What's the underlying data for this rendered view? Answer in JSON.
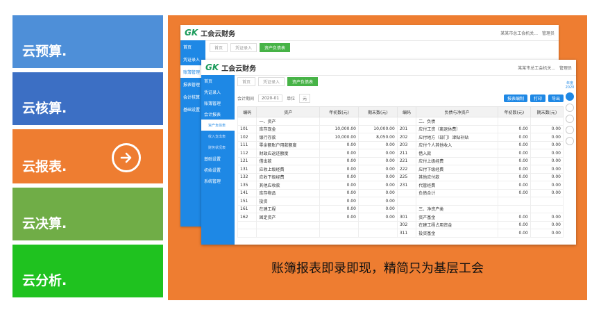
{
  "tiles": [
    {
      "label": "云预算."
    },
    {
      "label": "云核算."
    },
    {
      "label": "云报表."
    },
    {
      "label": "云决算."
    },
    {
      "label": "云分析."
    }
  ],
  "caption": "账簿报表即录即现，精简只为基层工会",
  "app": {
    "logo_mark": "GK",
    "title": "工会云财务",
    "org": "某某市总工会机关...",
    "user": "管理员"
  },
  "back_sidebar": [
    "首页",
    "凭证录入",
    "账簿管理",
    "报表管理",
    "会计核算",
    "基础设置"
  ],
  "front_sidebar": [
    {
      "label": "首页",
      "sub": false
    },
    {
      "label": "凭证录入",
      "sub": false
    },
    {
      "label": "账簿管理",
      "sub": false
    },
    {
      "label": "会计报表",
      "sub": false
    },
    {
      "label": "资产负债表",
      "sub": true,
      "on": true
    },
    {
      "label": "收入支出表",
      "sub": true
    },
    {
      "label": "财务状况表",
      "sub": true
    },
    {
      "label": "基础设置",
      "sub": false
    },
    {
      "label": "初始设置",
      "sub": false
    },
    {
      "label": "系统管理",
      "sub": false
    }
  ],
  "tabs": [
    "首页",
    "凭证录入",
    "资产负债表"
  ],
  "filters": {
    "period_label": "会计期间",
    "period": "2020-01",
    "unit_label": "单位",
    "unit": "元"
  },
  "buttons": [
    "报表编制",
    "打印",
    "导出"
  ],
  "year": {
    "label": "年度",
    "value": "2020"
  },
  "table": {
    "headers": [
      "编码",
      "资产",
      "年初数(元)",
      "期末数(元)",
      "编码",
      "负债与净资产",
      "年初数(元)",
      "期末数(元)"
    ],
    "rows": [
      [
        "",
        "一、资产",
        "",
        "",
        "",
        "二、负债",
        "",
        ""
      ],
      [
        "101",
        "库存现金",
        "10,000.00",
        "10,000.00",
        "201",
        "应付工资（离退休费）",
        "0.00",
        "0.00"
      ],
      [
        "102",
        "银行存款",
        "10,000.00",
        "8,050.00",
        "202",
        "应付地方（部门）津贴补贴",
        "0.00",
        "0.00"
      ],
      [
        "111",
        "零余额账户用款额度",
        "0.00",
        "0.00",
        "203",
        "应付个人其他收入",
        "0.00",
        "0.00"
      ],
      [
        "112",
        "财政应返还额度",
        "0.00",
        "0.00",
        "211",
        "借入款",
        "0.00",
        "0.00"
      ],
      [
        "121",
        "借出款",
        "0.00",
        "0.00",
        "221",
        "应付上级经费",
        "0.00",
        "0.00"
      ],
      [
        "131",
        "应收上级经费",
        "0.00",
        "0.00",
        "222",
        "应付下级经费",
        "0.00",
        "0.00"
      ],
      [
        "132",
        "应收下级经费",
        "0.00",
        "0.00",
        "225",
        "其他应付款",
        "0.00",
        "0.00"
      ],
      [
        "135",
        "其他应收款",
        "0.00",
        "0.00",
        "231",
        "代管经费",
        "0.00",
        "0.00"
      ],
      [
        "141",
        "库存物品",
        "0.00",
        "0.00",
        "",
        "负债合计",
        "0.00",
        "0.00"
      ],
      [
        "151",
        "投资",
        "0.00",
        "0.00",
        "",
        "",
        "",
        ""
      ],
      [
        "161",
        "在建工程",
        "0.00",
        "0.00",
        "",
        "三、净资产类",
        "",
        ""
      ],
      [
        "162",
        "固定资产",
        "0.00",
        "0.00",
        "301",
        "资产基金",
        "0.00",
        "0.00"
      ],
      [
        "",
        "",
        "",
        "",
        "302",
        "在建工程占用资金",
        "0.00",
        "0.00"
      ],
      [
        "",
        "",
        "",
        "",
        "311",
        "投资基金",
        "0.00",
        "0.00"
      ]
    ]
  }
}
